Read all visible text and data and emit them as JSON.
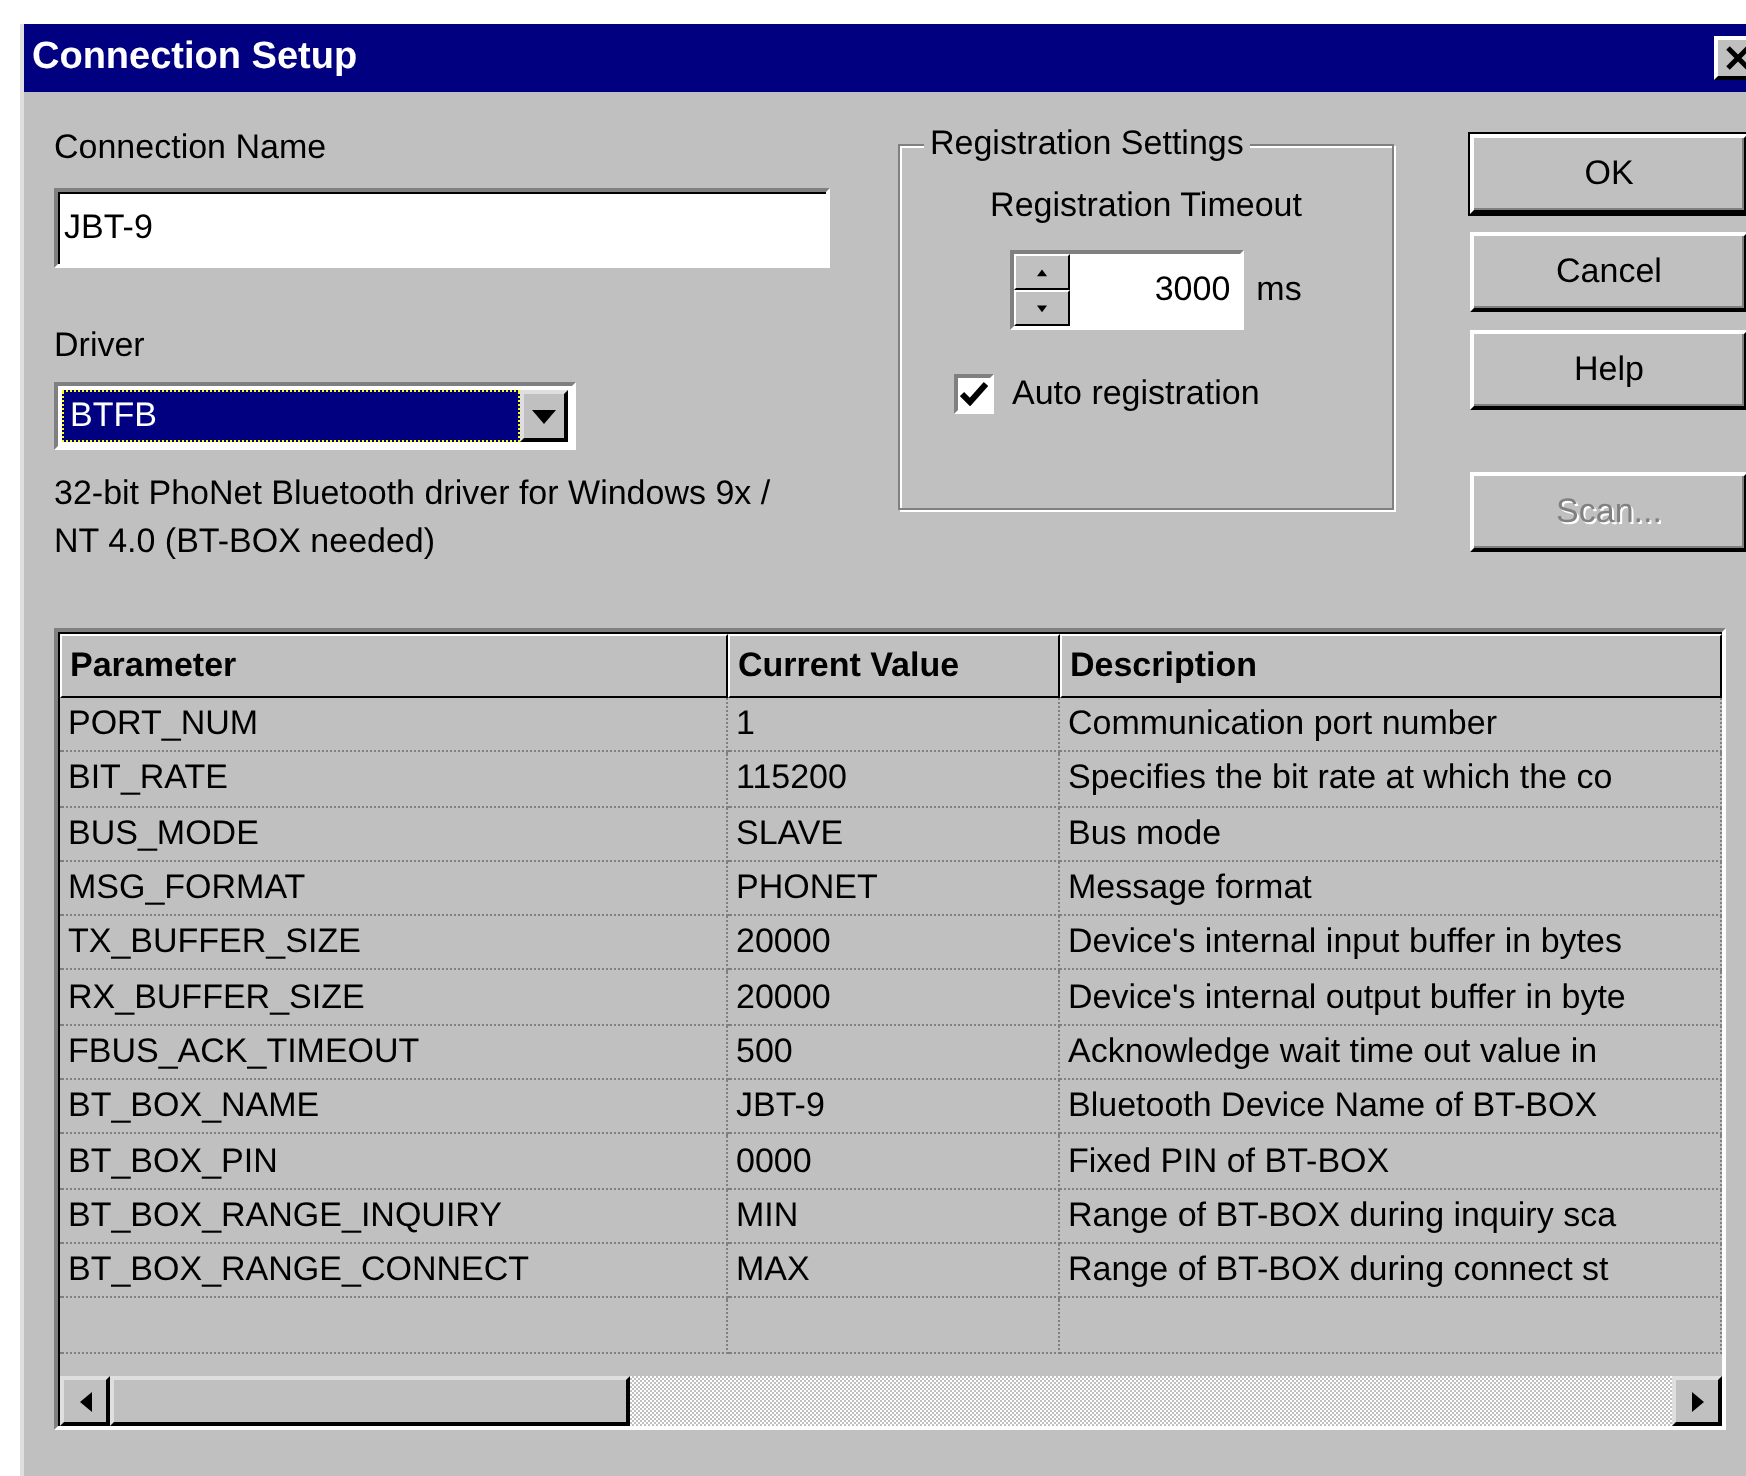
{
  "window": {
    "title": "Connection Setup"
  },
  "connection_name": {
    "label": "Connection Name",
    "value": "JBT-9"
  },
  "driver": {
    "label": "Driver",
    "value": "BTFB",
    "selected": true,
    "description": "32-bit PhoNet Bluetooth driver for Windows 9x / NT 4.0 (BT-BOX needed)"
  },
  "registration_settings": {
    "title": "Registration Settings",
    "timeout_label": "Registration Timeout",
    "timeout_value": "3000",
    "timeout_unit": "ms",
    "auto_registration": {
      "label": "Auto registration",
      "checked": true
    }
  },
  "buttons": [
    {
      "label": "OK",
      "default": true,
      "disabled": false
    },
    {
      "label": "Cancel",
      "default": false,
      "disabled": false
    },
    {
      "label": "Help",
      "default": false,
      "disabled": false
    },
    {
      "label": "Scan...",
      "default": false,
      "disabled": true
    }
  ],
  "table": {
    "columns": [
      "Parameter",
      "Current Value",
      "Description"
    ],
    "rows": [
      [
        "PORT_NUM",
        "1",
        "Communication port number"
      ],
      [
        "BIT_RATE",
        "115200",
        "Specifies the bit rate at which the co"
      ],
      [
        "BUS_MODE",
        "SLAVE",
        "Bus mode"
      ],
      [
        "MSG_FORMAT",
        "PHONET",
        "Message format"
      ],
      [
        "TX_BUFFER_SIZE",
        "20000",
        "Device's internal input buffer in bytes"
      ],
      [
        "RX_BUFFER_SIZE",
        "20000",
        "Device's internal output buffer in byte"
      ],
      [
        "FBUS_ACK_TIMEOUT",
        "500",
        "Acknowledge wait time out value in"
      ],
      [
        "BT_BOX_NAME",
        "JBT-9",
        "Bluetooth Device Name of BT-BOX"
      ],
      [
        "BT_BOX_PIN",
        "0000",
        "Fixed PIN of BT-BOX"
      ],
      [
        "BT_BOX_RANGE_INQUIRY",
        "MIN",
        "Range of BT-BOX during inquiry sca"
      ],
      [
        "BT_BOX_RANGE_CONNECT",
        "MAX",
        "Range of BT-BOX during connect st"
      ]
    ]
  }
}
